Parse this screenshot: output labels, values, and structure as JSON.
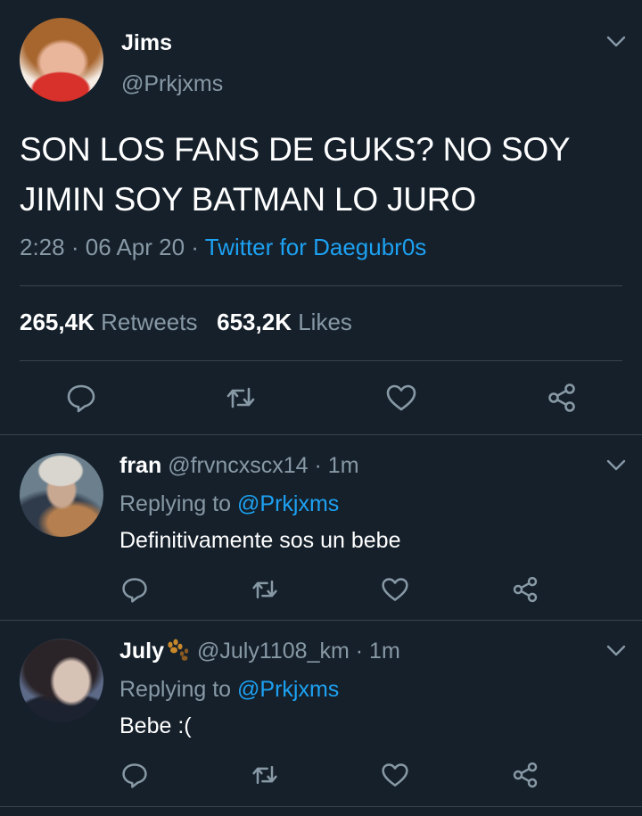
{
  "main_tweet": {
    "name": "Jims",
    "handle": "@Prkjxms",
    "text": "SON LOS FANS DE GUKS? NO SOY JIMIN SOY BATMAN LO JURO",
    "time": "2:28",
    "date": "06 Apr 20",
    "sep": "·",
    "source": "Twitter for Daegubr0s",
    "retweets_count": "265,4K",
    "retweets_label": "Retweets",
    "likes_count": "653,2K",
    "likes_label": "Likes"
  },
  "replies": [
    {
      "name": "fran",
      "handle": "@frvncxscx14",
      "time": "1m",
      "replying_label": "Replying to",
      "replying_to": "@Prkjxms",
      "text": "Definitivamente sos un bebe"
    },
    {
      "name": "July",
      "handle": "@July1108_km",
      "time": "1m",
      "replying_label": "Replying to",
      "replying_to": "@Prkjxms",
      "text": "Bebe :("
    }
  ],
  "icons": {
    "reply": "comment-icon",
    "retweet": "retweet-icon",
    "like": "heart-icon",
    "share": "share-icon",
    "menu": "chevron-down-icon"
  },
  "colors": {
    "background": "#15202b",
    "link": "#1da1f2",
    "muted": "#8899a6",
    "divider": "#38444d"
  }
}
